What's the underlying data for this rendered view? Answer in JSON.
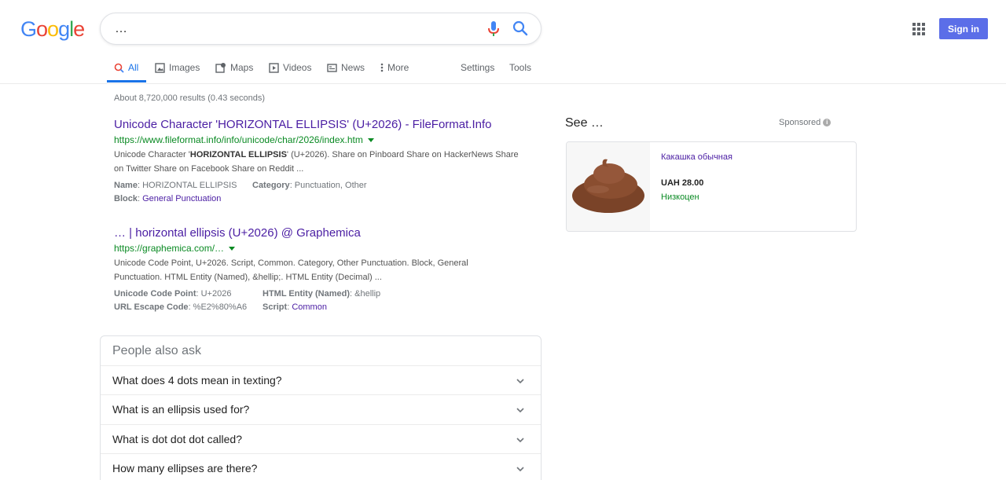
{
  "header": {
    "logo_letters": [
      "G",
      "o",
      "o",
      "g",
      "l",
      "e"
    ],
    "logo_colors": [
      "#4285f4",
      "#ea4335",
      "#fbbc05",
      "#4285f4",
      "#34a853",
      "#ea4335"
    ],
    "search_value": "…",
    "signin_label": "Sign in",
    "accent_color": "#5b6ee8"
  },
  "tabs": {
    "all": "All",
    "images": "Images",
    "maps": "Maps",
    "videos": "Videos",
    "news": "News",
    "more": "More",
    "settings": "Settings",
    "tools": "Tools"
  },
  "results": {
    "stats": "About 8,720,000 results (0.43 seconds)",
    "r1": {
      "title": "Unicode Character 'HORIZONTAL ELLIPSIS' (U+2026) - FileFormat.Info",
      "url": "https://www.fileformat.info/info/unicode/char/2026/index.htm",
      "snippet_pre": "Unicode Character '",
      "snippet_bold": "HORIZONTAL ELLIPSIS",
      "snippet_post": "' (U+2026). Share on Pinboard Share on HackerNews Share on Twitter Share on Facebook Share on Reddit ...",
      "attr_name_k": "Name",
      "attr_name_v": ": HORIZONTAL ELLIPSIS",
      "attr_cat_k": "Category",
      "attr_cat_v": ": Punctuation, Other",
      "attr_block_k": "Block",
      "attr_block_sep": ": ",
      "attr_block_v": "General Punctuation"
    },
    "r2": {
      "title": "… | horizontal ellipsis (U+2026) @ Graphemica",
      "url": "https://graphemica.com/…",
      "snippet": "Unicode Code Point, U+2026. Script, Common. Category, Other Punctuation. Block, General Punctuation. HTML Entity (Named), &hellip;. HTML Entity (Decimal) ...",
      "attr_cp_k": "Unicode Code Point",
      "attr_cp_v": ": U+2026",
      "attr_html_k": "HTML Entity (Named)",
      "attr_html_v": ": &hellip",
      "attr_url_k": "URL Escape Code",
      "attr_url_v": ": %E2%80%A6",
      "attr_script_k": "Script",
      "attr_script_sep": ": ",
      "attr_script_v": "Common"
    }
  },
  "paa": {
    "title": "People also ask",
    "questions": [
      "What does 4 dots mean in texting?",
      "What is an ellipsis used for?",
      "What is dot dot dot called?",
      "How many ellipses are there?"
    ]
  },
  "ads": {
    "see_title": "See …",
    "sponsored": "Sponsored",
    "info_glyph": "i",
    "item_name": "Какашка обычная",
    "item_price": "UAH 28.00",
    "item_shop": "Низкоцен"
  }
}
